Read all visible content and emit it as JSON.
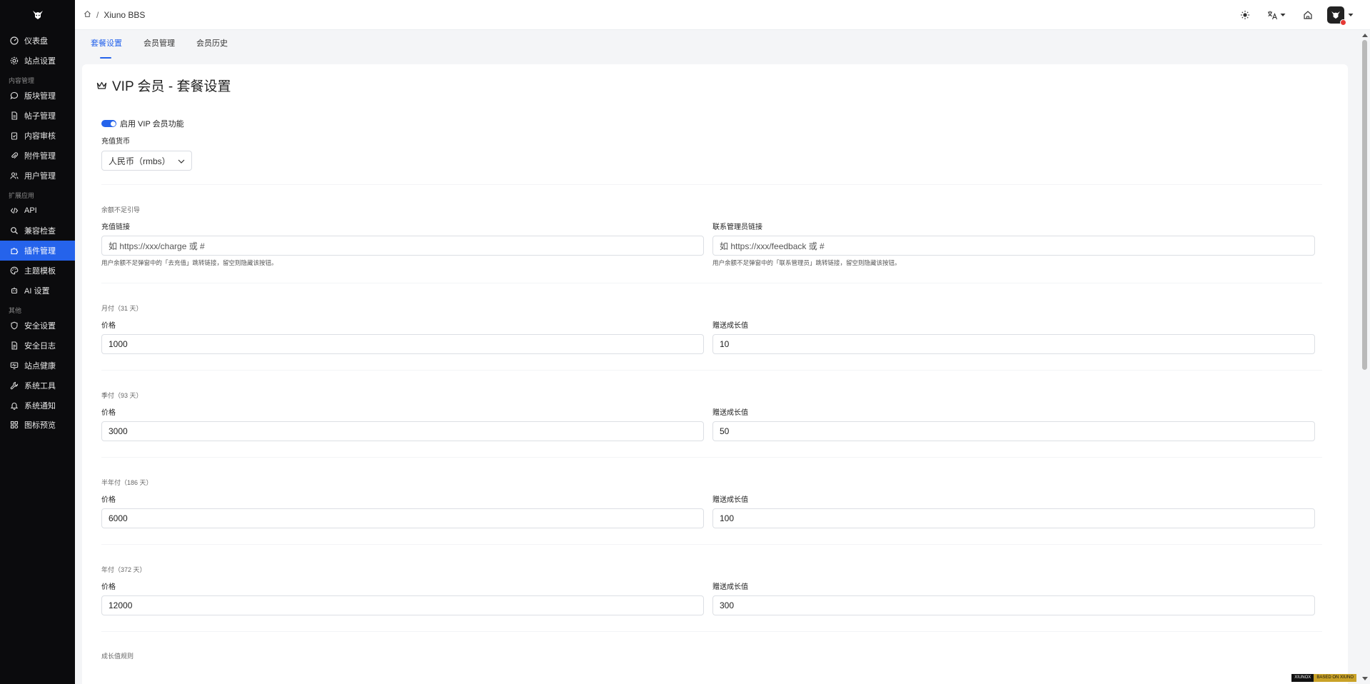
{
  "sidebar": {
    "items": [
      {
        "label": "仪表盘",
        "icon": "gauge-icon"
      },
      {
        "label": "站点设置",
        "icon": "gear-icon"
      }
    ],
    "groups": [
      {
        "title": "内容管理",
        "items": [
          {
            "label": "版块管理",
            "icon": "chat-bubble-icon"
          },
          {
            "label": "帖子管理",
            "icon": "document-icon"
          },
          {
            "label": "内容审核",
            "icon": "clipboard-check-icon"
          },
          {
            "label": "附件管理",
            "icon": "paperclip-icon"
          },
          {
            "label": "用户管理",
            "icon": "users-icon"
          }
        ]
      },
      {
        "title": "扩展应用",
        "items": [
          {
            "label": "API",
            "icon": "code-icon"
          },
          {
            "label": "兼容检查",
            "icon": "search-icon"
          },
          {
            "label": "插件管理",
            "icon": "puzzle-icon",
            "active": true
          },
          {
            "label": "主题模板",
            "icon": "palette-icon"
          },
          {
            "label": "AI 设置",
            "icon": "robot-icon"
          }
        ]
      },
      {
        "title": "其他",
        "items": [
          {
            "label": "安全设置",
            "icon": "shield-icon"
          },
          {
            "label": "安全日志",
            "icon": "log-file-icon"
          },
          {
            "label": "站点健康",
            "icon": "monitor-heart-icon"
          },
          {
            "label": "系统工具",
            "icon": "wrench-icon"
          },
          {
            "label": "系统通知",
            "icon": "bell-icon"
          },
          {
            "label": "图标预览",
            "icon": "grid-icon"
          }
        ]
      }
    ]
  },
  "header": {
    "breadcrumb_site": "Xiuno BBS"
  },
  "tabs": [
    {
      "label": "套餐设置",
      "active": true
    },
    {
      "label": "会员管理"
    },
    {
      "label": "会员历史"
    }
  ],
  "page": {
    "title": "VIP 会员 - 套餐设置",
    "enable_label": "启用 VIP 会员功能",
    "currency_label": "充值货币",
    "currency_value": "人民币（rmbs）",
    "insufficient_section": "余额不足引导",
    "charge_link_label": "充值链接",
    "charge_link_placeholder": "如 https://xxx/charge 或 #",
    "charge_link_hint": "用户余额不足弹窗中的「去充值」跳转链接，留空则隐藏该按钮。",
    "admin_link_label": "联系管理员链接",
    "admin_link_placeholder": "如 https://xxx/feedback 或 #",
    "admin_link_hint": "用户余额不足弹窗中的「联系管理员」跳转链接，留空则隐藏该按钮。",
    "plans": [
      {
        "title": "月付（31 天）",
        "price_label": "价格",
        "price": "1000",
        "growth_label": "赠送成长值",
        "growth": "10"
      },
      {
        "title": "季付（93 天）",
        "price_label": "价格",
        "price": "3000",
        "growth_label": "赠送成长值",
        "growth": "50"
      },
      {
        "title": "半年付（186 天）",
        "price_label": "价格",
        "price": "6000",
        "growth_label": "赠送成长值",
        "growth": "100"
      },
      {
        "title": "年付（372 天）",
        "price_label": "价格",
        "price": "12000",
        "growth_label": "赠送成长值",
        "growth": "300"
      }
    ],
    "growth_rules": "成长值规则"
  },
  "watermark": {
    "left": "XIUNOX",
    "right": "BASED ON XIUNO"
  },
  "colors": {
    "accent": "#2563eb",
    "sidebar_bg": "#0b0b0d"
  }
}
